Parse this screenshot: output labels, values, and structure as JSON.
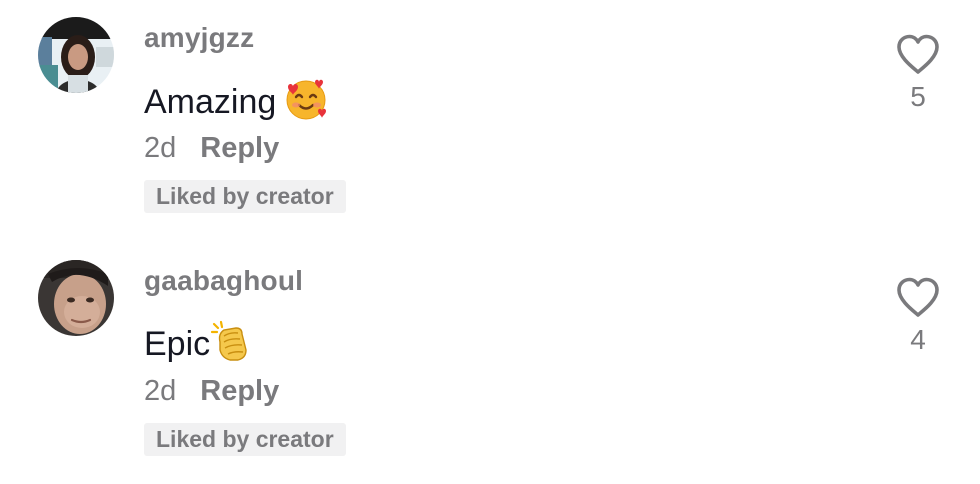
{
  "comments": [
    {
      "username": "amyjgzz",
      "text": "Amazing",
      "emoji_icon": "smiling-face-with-hearts-icon",
      "age": "2d",
      "reply_label": "Reply",
      "badge": "Liked by creator",
      "likes": "5"
    },
    {
      "username": "gaabaghoul",
      "text": "Epic",
      "emoji_icon": "clapping-hands-icon",
      "age": "2d",
      "reply_label": "Reply",
      "badge": "Liked by creator",
      "likes": "4"
    }
  ],
  "colors": {
    "secondary_text": "#7a7a7d",
    "primary_text": "#161823",
    "badge_bg": "#f1f1f2"
  }
}
